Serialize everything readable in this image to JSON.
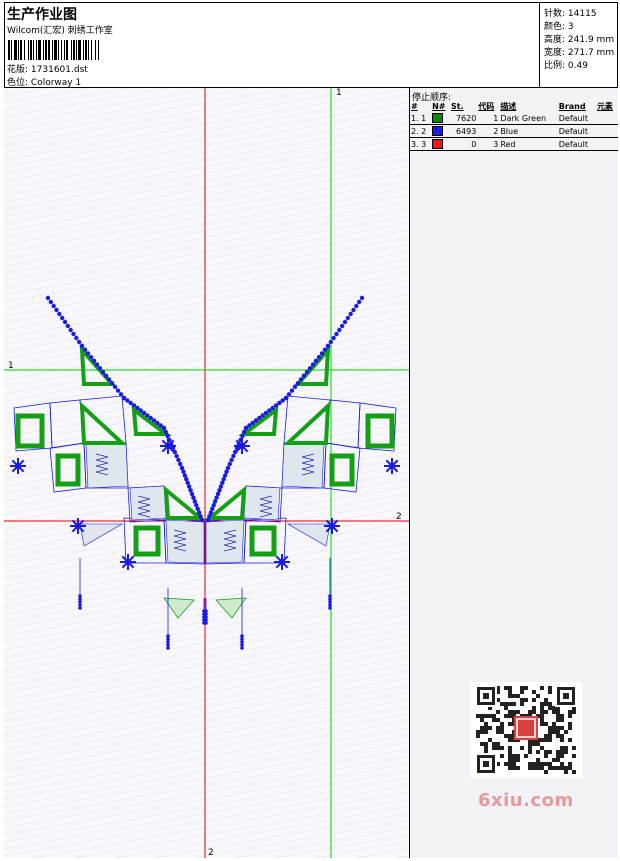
{
  "header": {
    "title": "生产作业图",
    "subtitle": "Wilcom(汇宏) 刺绣工作室",
    "design_label": "花版:",
    "design_value": "1731601.dst",
    "color_label": "色位:",
    "color_value": "Colorway 1"
  },
  "stats": {
    "stitches_label": "针数:",
    "stitches_value": "14115",
    "colors_label": "颜色:",
    "colors_value": "3",
    "height_label": "高度:",
    "height_value": "241.9 mm",
    "width_label": "宽度:",
    "width_value": "271.7 mm",
    "scale_label": "比例:",
    "scale_value": "0.49"
  },
  "stop_sequence": {
    "title": "停止顺序:",
    "columns": [
      "#",
      "N#",
      "St.",
      "代码",
      "描述",
      "Brand",
      "元素"
    ],
    "rows": [
      {
        "idx": "1. 1",
        "color": "#0a8a0a",
        "st": "7620",
        "code": "1",
        "desc": "Dark Green",
        "brand": "Default",
        "el": ""
      },
      {
        "idx": "2. 2",
        "color": "#1a1ae8",
        "st": "6493",
        "code": "2",
        "desc": "Blue",
        "brand": "Default",
        "el": ""
      },
      {
        "idx": "3. 3",
        "color": "#e81a1a",
        "st": "0",
        "code": "3",
        "desc": "Red",
        "brand": "Default",
        "el": ""
      }
    ]
  },
  "axes": {
    "green_top": "1",
    "green_left": "1",
    "red_right": "2",
    "red_bottom": "2"
  },
  "colors": {
    "green_thread": "#14a014",
    "blue_thread": "#1a1ae8",
    "red_axis": "#e00000",
    "green_axis": "#00d000"
  },
  "watermark": "6xiu.com"
}
